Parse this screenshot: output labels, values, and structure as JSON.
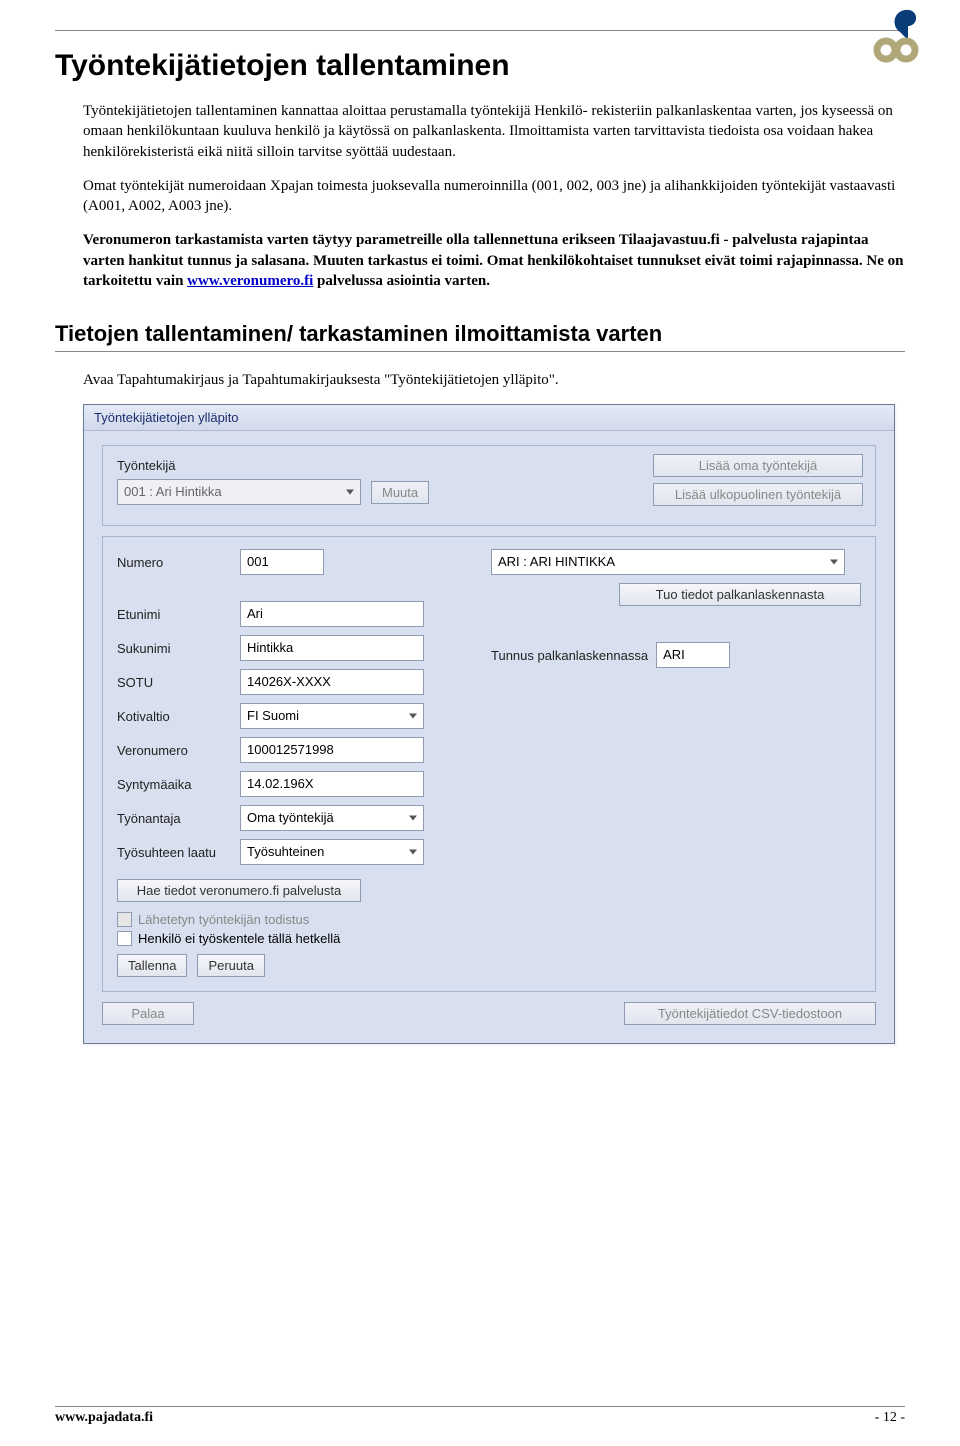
{
  "header": {
    "logo_alt": "pajadata-logo"
  },
  "title": "Työntekijätietojen tallentaminen",
  "paragraphs": {
    "p1": "Työntekijätietojen tallentaminen kannattaa aloittaa perustamalla työntekijä Henkilö- rekisteriin palkanlaskentaa varten, jos kyseessä on omaan henkilökuntaan kuuluva henkilö ja käytössä on palkanlaskenta. Ilmoittamista varten tarvittavista tiedoista osa voidaan hakea henkilörekisteristä eikä niitä silloin tarvitse syöttää uudestaan.",
    "p2": "Omat työntekijät numeroidaan Xpajan toimesta juoksevalla numeroinnilla (001, 002, 003 jne) ja alihankkijoiden työntekijät vastaavasti (A001, A002, A003 jne).",
    "p3_a": "Veronumeron tarkastamista varten täytyy parametreille olla tallennettuna erikseen Tilaajavastuu.fi - palvelusta rajapintaa varten hankitut tunnus ja salasana. Muuten tarkastus ei toimi. Omat henkilökohtaiset tunnukset eivät toimi rajapinnassa. Ne on tarkoitettu vain ",
    "p3_link": "www.veronumero.fi",
    "p3_b": " palvelussa asiointia varten."
  },
  "subheading": "Tietojen tallentaminen/ tarkastaminen ilmoittamista varten",
  "subtext": "Avaa Tapahtumakirjaus ja Tapahtumakirjauksesta \"Työntekijätietojen ylläpito\".",
  "form": {
    "window_title": "Työntekijätietojen ylläpito",
    "top": {
      "label": "Työntekijä",
      "employee_select_value": "001 : Ari Hintikka",
      "muuta_btn": "Muuta",
      "add_own_btn": "Lisää oma työntekijä",
      "add_ext_btn": "Lisää ulkopuolinen työntekijä"
    },
    "fields": {
      "numero_label": "Numero",
      "numero_value": "001",
      "etunimi_label": "Etunimi",
      "etunimi_value": "Ari",
      "sukunimi_label": "Sukunimi",
      "sukunimi_value": "Hintikka",
      "sotu_label": "SOTU",
      "sotu_value": "14026X-XXXX",
      "kotivaltio_label": "Kotivaltio",
      "kotivaltio_value": "FI Suomi",
      "veronumero_label": "Veronumero",
      "veronumero_value": "100012571998",
      "synt_label": "Syntymäaika",
      "synt_value": "14.02.196X",
      "tyonantaja_label": "Työnantaja",
      "tyonantaja_value": "Oma työntekijä",
      "laatu_label": "Työsuhteen laatu",
      "laatu_value": "Työsuhteinen",
      "hae_btn": "Hae tiedot veronumero.fi palvelusta",
      "chk1": "Lähetetyn työntekijän todistus",
      "chk2": "Henkilö ei työskentele tällä hetkellä",
      "tallenna_btn": "Tallenna",
      "peruuta_btn": "Peruuta"
    },
    "right": {
      "person_select": "ARI : ARI HINTIKKA",
      "tuo_btn": "Tuo tiedot palkanlaskennasta",
      "tunnus_label": "Tunnus palkanlaskennassa",
      "tunnus_value": "ARI"
    },
    "bottom": {
      "palaa_btn": "Palaa",
      "csv_btn": "Työntekijätiedot CSV-tiedostoon"
    }
  },
  "footer": {
    "left": "www.pajadata.fi",
    "right": "- 12 -"
  }
}
